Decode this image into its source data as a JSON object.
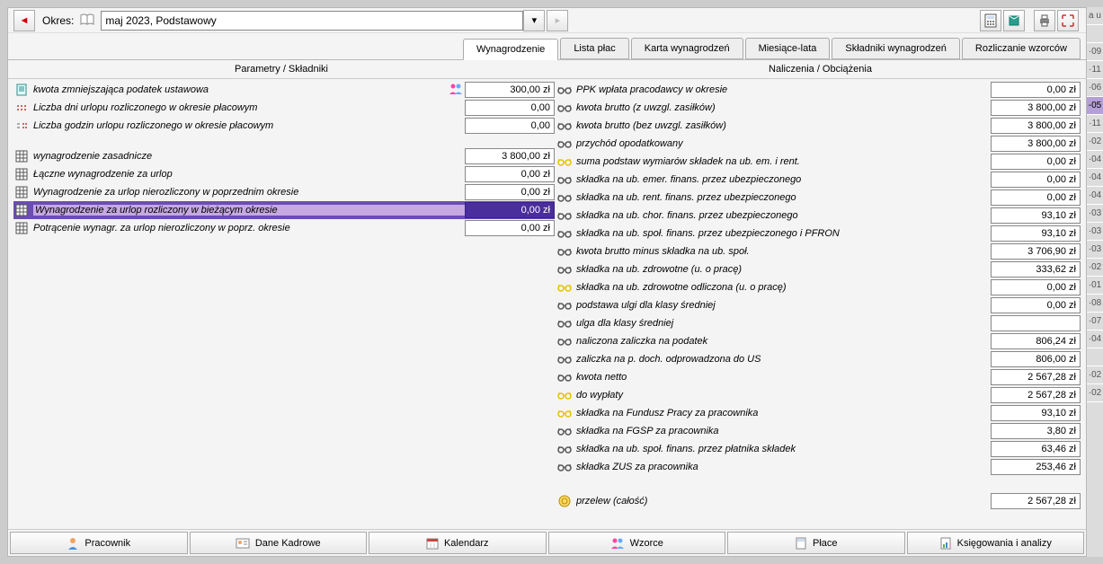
{
  "toolbar": {
    "period_label": "Okres:",
    "period_value": "maj 2023, Podstawowy"
  },
  "tabs": [
    {
      "label": "Wynagrodzenie",
      "active": true
    },
    {
      "label": "Lista płac",
      "active": false
    },
    {
      "label": "Karta wynagrodzeń",
      "active": false
    },
    {
      "label": "Miesiące-lata",
      "active": false
    },
    {
      "label": "Składniki wynagrodzeń",
      "active": false
    },
    {
      "label": "Rozliczanie wzorców",
      "active": false
    }
  ],
  "headers": {
    "left": "Parametry / Składniki",
    "right": "Naliczenia / Obciążenia"
  },
  "left_rows_a": [
    {
      "label": "kwota zmniejszająca podatek ustawowa",
      "value": "300,00 zł",
      "icon": "doc",
      "extra": true
    },
    {
      "label": "Liczba dni urlopu rozliczonego w okresie płacowym",
      "value": "0,00",
      "icon": "dots"
    },
    {
      "label": "Liczba godzin urlopu rozliczonego w okresie płacowym",
      "value": "0,00",
      "icon": "dots2"
    }
  ],
  "left_rows_b": [
    {
      "label": "wynagrodzenie zasadnicze",
      "value": "3 800,00 zł",
      "icon": "grid"
    },
    {
      "label": "Łączne wynagrodzenie za urlop",
      "value": "0,00 zł",
      "icon": "grid"
    },
    {
      "label": "Wynagrodzenie za urlop nierozliczony w poprzednim okresie",
      "value": "0,00 zł",
      "icon": "grid"
    },
    {
      "label": "Wynagrodzenie za urlop rozliczony w bieżącym okresie",
      "value": "0,00 zł",
      "icon": "grid",
      "selected": true
    },
    {
      "label": "Potrącenie wynagr. za urlop nierozliczony w poprz. okresie",
      "value": "0,00 zł",
      "icon": "grid"
    }
  ],
  "right_rows": [
    {
      "label": "PPK wpłata pracodawcy w okresie",
      "value": "0,00 zł"
    },
    {
      "label": "kwota brutto (z uwzgl. zasiłków)",
      "value": "3 800,00 zł"
    },
    {
      "label": "kwota brutto (bez uwzgl. zasiłków)",
      "value": "3 800,00 zł"
    },
    {
      "label": "przychód opodatkowany",
      "value": "3 800,00 zł"
    },
    {
      "label": "suma podstaw wymiarów składek na ub. em. i rent.",
      "value": "0,00 zł",
      "yellow": true
    },
    {
      "label": "składka na ub. emer. finans. przez ubezpieczonego",
      "value": "0,00 zł"
    },
    {
      "label": "składka na ub. rent. finans. przez ubezpieczonego",
      "value": "0,00 zł"
    },
    {
      "label": "składka na ub. chor. finans. przez ubezpieczonego",
      "value": "93,10 zł"
    },
    {
      "label": "składka na ub. społ. finans. przez ubezpieczonego i PFRON",
      "value": "93,10 zł"
    },
    {
      "label": "kwota brutto minus składka na ub. społ.",
      "value": "3 706,90 zł"
    },
    {
      "label": "składka na ub. zdrowotne (u. o pracę)",
      "value": "333,62 zł"
    },
    {
      "label": "składka na ub. zdrowotne odliczona (u. o pracę)",
      "value": "0,00 zł",
      "yellow": true
    },
    {
      "label": "podstawa ulgi dla klasy średniej",
      "value": "0,00 zł"
    },
    {
      "label": "ulga dla klasy średniej",
      "value": ""
    },
    {
      "label": "naliczona zaliczka na podatek",
      "value": "806,24 zł"
    },
    {
      "label": "zaliczka na p. doch. odprowadzona do US",
      "value": "806,00 zł"
    },
    {
      "label": "kwota netto",
      "value": "2 567,28 zł"
    },
    {
      "label": "do wypłaty",
      "value": "2 567,28 zł",
      "yellow": true
    },
    {
      "label": "składka na Fundusz Pracy za pracownika",
      "value": "93,10 zł",
      "yellow": true
    },
    {
      "label": "składka na FGŚP za pracownika",
      "value": "3,80 zł"
    },
    {
      "label": "składka na ub. społ. finans. przez płatnika składek",
      "value": "63,46 zł"
    },
    {
      "label": "składka ZUS za pracownika",
      "value": "253,46 zł"
    }
  ],
  "transfer": {
    "label": "przelew (całość)",
    "value": "2 567,28 zł"
  },
  "bottom": [
    {
      "label": "Pracownik",
      "icon": "person"
    },
    {
      "label": "Dane Kadrowe",
      "icon": "card"
    },
    {
      "label": "Kalendarz",
      "icon": "calendar"
    },
    {
      "label": "Wzorce",
      "icon": "people"
    },
    {
      "label": "Płace",
      "icon": "calc"
    },
    {
      "label": "Księgowania i analizy",
      "icon": "report"
    }
  ],
  "sidecol": [
    "a u",
    "",
    "·09",
    "·11",
    "·06",
    "-05",
    "·11",
    "·02",
    "·04",
    "·04",
    "·04",
    "·03",
    "·03",
    "·03",
    "·02",
    "·01",
    "·08",
    "·07",
    "·04",
    "",
    "·02",
    "·02"
  ]
}
